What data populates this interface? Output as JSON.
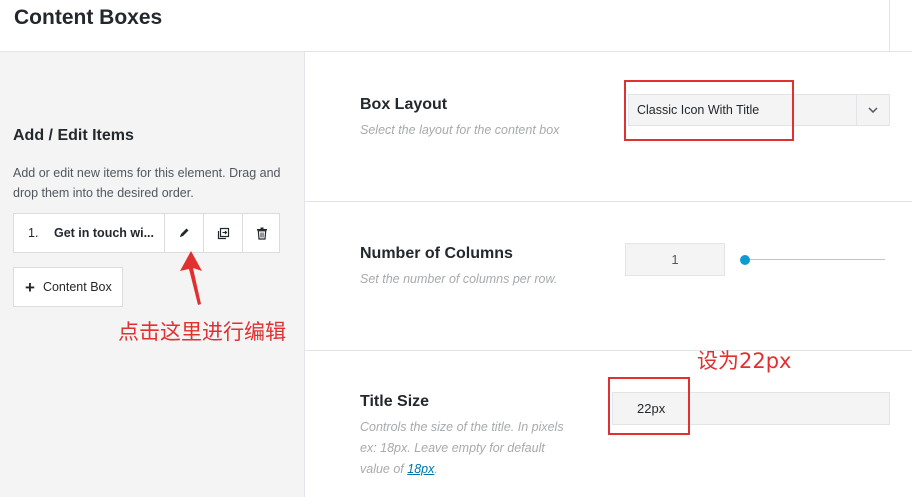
{
  "header": {
    "title": "Content Boxes"
  },
  "sidebar": {
    "heading": "Add / Edit Items",
    "description": "Add or edit new items for this element. Drag and drop them into the desired order.",
    "items": [
      {
        "number": "1.",
        "label": "Get in touch wi..."
      }
    ],
    "add_button_label": "Content Box"
  },
  "settings": {
    "box_layout": {
      "title": "Box Layout",
      "description": "Select the layout for the content box",
      "selected": "Classic Icon With Title"
    },
    "columns": {
      "title": "Number of Columns",
      "description": "Set the number of columns per row.",
      "value": "1",
      "slider_fraction": 0
    },
    "title_size": {
      "title": "Title Size",
      "description_prefix": "Controls the size of the title. In pixels ex: 18px. Leave empty for default value of ",
      "link_text": "18px",
      "description_suffix": ".",
      "value": "22px"
    }
  },
  "annotations": {
    "edit_hint": "点击这里进行编辑",
    "size_hint": "设为22px",
    "color": "#e03030"
  },
  "icons": [
    "pencil-icon",
    "clone-icon",
    "trash-icon",
    "chevron-down-icon",
    "plus-icon"
  ]
}
